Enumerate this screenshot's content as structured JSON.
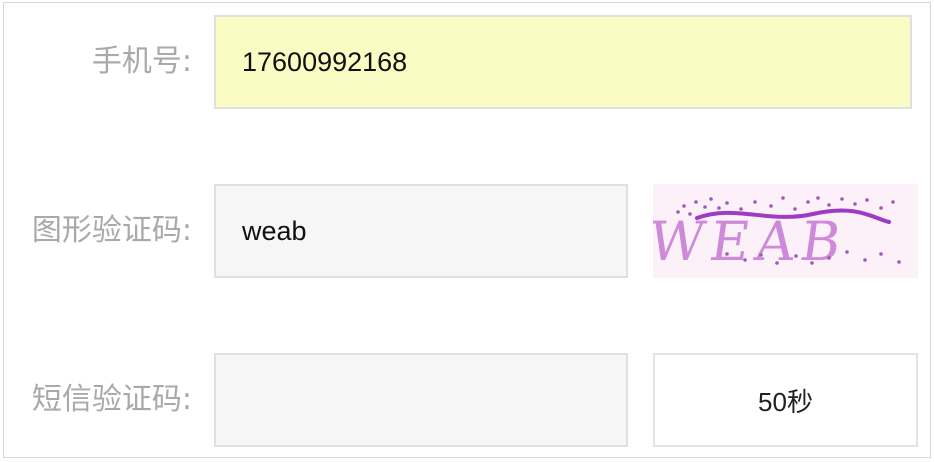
{
  "form": {
    "phone": {
      "label": "手机号:",
      "value": "17600992168"
    },
    "image_captcha": {
      "label": "图形验证码:",
      "value": "weab",
      "image_text": "WEAB"
    },
    "sms_code": {
      "label": "短信验证码:",
      "value": "",
      "countdown_label": "50秒"
    }
  },
  "colors": {
    "label": "#a9a9a9",
    "phone_bg": "#fafcc4",
    "input_bg": "#f6f6f6",
    "captcha_bg": "#fcf1f8",
    "captcha_ink": "#b160c8"
  }
}
